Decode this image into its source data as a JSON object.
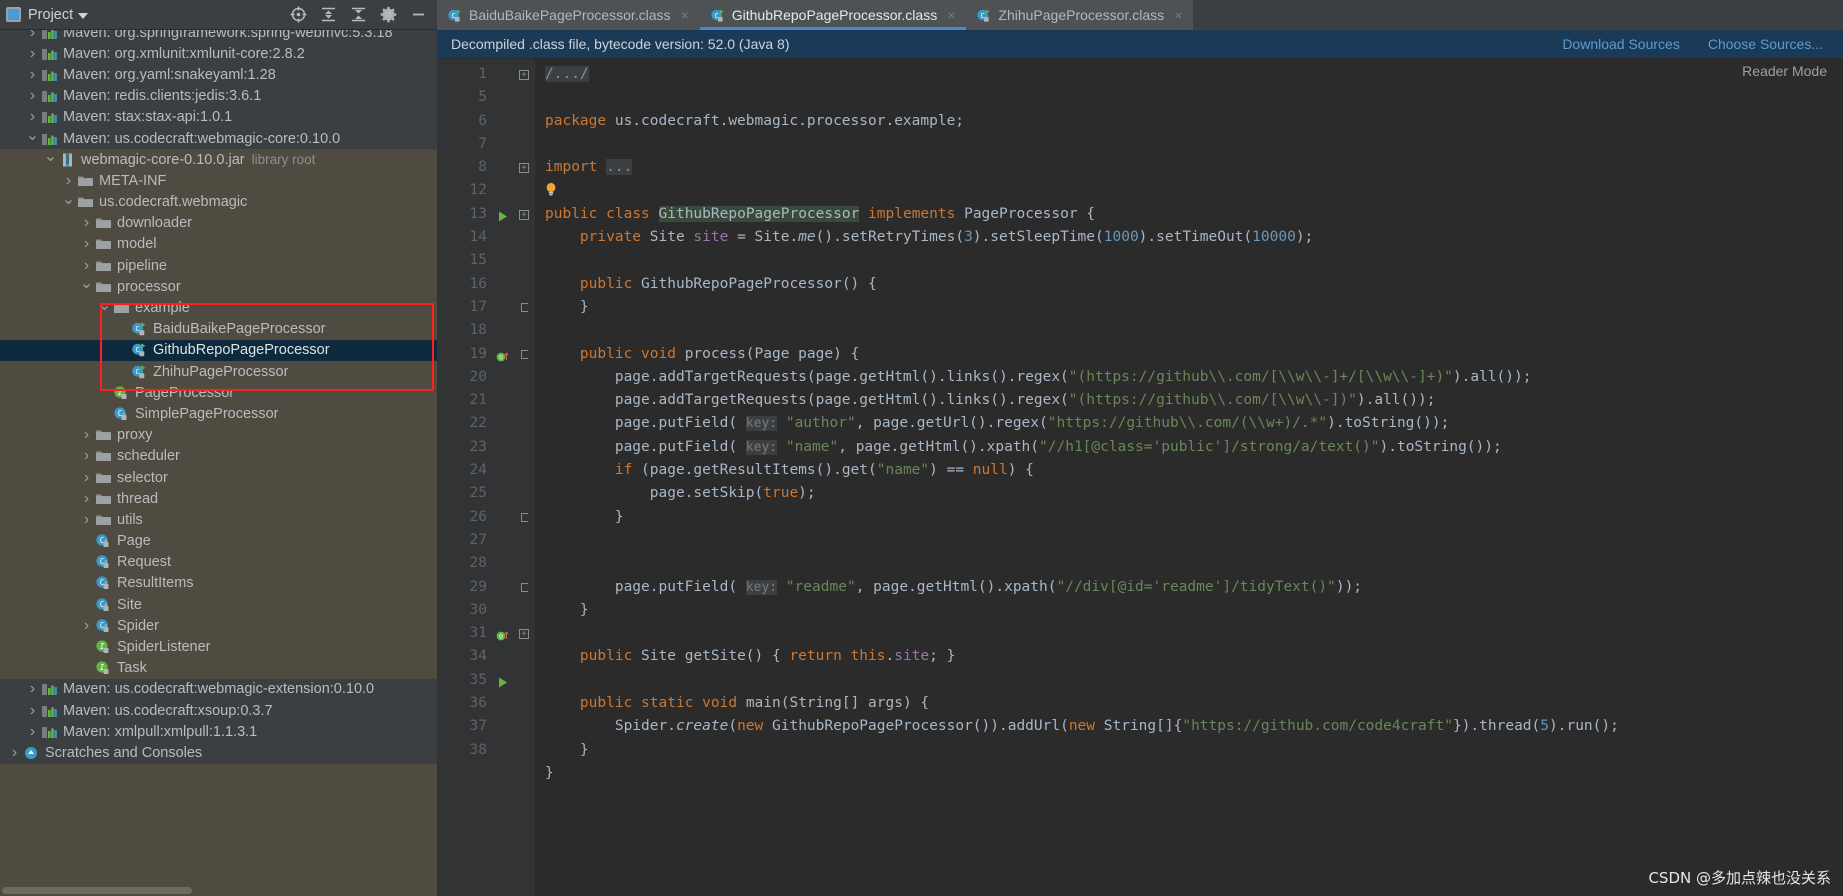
{
  "toolwindow": {
    "title": "Project",
    "icons": [
      "project-icon",
      "locate-icon",
      "expand-all-icon",
      "collapse-all-icon",
      "settings-gear-icon",
      "hide-icon"
    ]
  },
  "tabs": [
    {
      "label": "BaiduBaikePageProcessor.class",
      "active": false,
      "close": "×"
    },
    {
      "label": "GithubRepoPageProcessor.class",
      "active": true,
      "close": "×"
    },
    {
      "label": "ZhihuPageProcessor.class",
      "active": false,
      "close": "×"
    }
  ],
  "notice": {
    "text": "Decompiled .class file, bytecode version: 52.0 (Java 8)",
    "download_sources": "Download Sources",
    "choose_sources": "Choose Sources...",
    "reader_mode": "Reader Mode"
  },
  "tree": [
    {
      "indent": 2,
      "arrow": "›",
      "icon": "maven-lib-icon",
      "label": "Maven: org.springframework:spring-webmvc:5.3.18",
      "cut_top": true,
      "dark": true
    },
    {
      "indent": 2,
      "arrow": "›",
      "icon": "maven-lib-icon",
      "label": "Maven: org.xmlunit:xmlunit-core:2.8.2",
      "dark": true
    },
    {
      "indent": 2,
      "arrow": "›",
      "icon": "maven-lib-icon",
      "label": "Maven: org.yaml:snakeyaml:1.28",
      "dark": true
    },
    {
      "indent": 2,
      "arrow": "›",
      "icon": "maven-lib-icon",
      "label": "Maven: redis.clients:jedis:3.6.1",
      "dark": true
    },
    {
      "indent": 2,
      "arrow": "›",
      "icon": "maven-lib-icon",
      "label": "Maven: stax:stax-api:1.0.1",
      "dark": true
    },
    {
      "indent": 2,
      "arrow": "⌄",
      "icon": "maven-lib-icon",
      "label": "Maven: us.codecraft:webmagic-core:0.10.0",
      "dark": true
    },
    {
      "indent": 3,
      "arrow": "⌄",
      "icon": "jar-icon",
      "label": "webmagic-core-0.10.0.jar",
      "note": "library root"
    },
    {
      "indent": 4,
      "arrow": "›",
      "icon": "folder-icon",
      "label": "META-INF"
    },
    {
      "indent": 4,
      "arrow": "⌄",
      "icon": "folder-icon",
      "label": "us.codecraft.webmagic"
    },
    {
      "indent": 5,
      "arrow": "›",
      "icon": "folder-icon",
      "label": "downloader"
    },
    {
      "indent": 5,
      "arrow": "›",
      "icon": "folder-icon",
      "label": "model"
    },
    {
      "indent": 5,
      "arrow": "›",
      "icon": "folder-icon",
      "label": "pipeline"
    },
    {
      "indent": 5,
      "arrow": "⌄",
      "icon": "folder-icon",
      "label": "processor"
    },
    {
      "indent": 6,
      "arrow": "⌄",
      "icon": "folder-icon",
      "label": "example"
    },
    {
      "indent": 7,
      "arrow": "",
      "icon": "class-runnable-icon",
      "label": "BaiduBaikePageProcessor"
    },
    {
      "indent": 7,
      "arrow": "",
      "icon": "class-runnable-icon",
      "label": "GithubRepoPageProcessor",
      "selected": true
    },
    {
      "indent": 7,
      "arrow": "",
      "icon": "class-runnable-icon",
      "label": "ZhihuPageProcessor"
    },
    {
      "indent": 6,
      "arrow": "",
      "icon": "interface-icon",
      "label": "PageProcessor"
    },
    {
      "indent": 6,
      "arrow": "",
      "icon": "class-icon",
      "label": "SimplePageProcessor"
    },
    {
      "indent": 5,
      "arrow": "›",
      "icon": "folder-icon",
      "label": "proxy"
    },
    {
      "indent": 5,
      "arrow": "›",
      "icon": "folder-icon",
      "label": "scheduler"
    },
    {
      "indent": 5,
      "arrow": "›",
      "icon": "folder-icon",
      "label": "selector"
    },
    {
      "indent": 5,
      "arrow": "›",
      "icon": "folder-icon",
      "label": "thread"
    },
    {
      "indent": 5,
      "arrow": "›",
      "icon": "folder-icon",
      "label": "utils"
    },
    {
      "indent": 5,
      "arrow": "",
      "icon": "class-icon",
      "label": "Page"
    },
    {
      "indent": 5,
      "arrow": "",
      "icon": "class-icon",
      "label": "Request"
    },
    {
      "indent": 5,
      "arrow": "",
      "icon": "class-icon",
      "label": "ResultItems"
    },
    {
      "indent": 5,
      "arrow": "",
      "icon": "class-icon",
      "label": "Site"
    },
    {
      "indent": 5,
      "arrow": "›",
      "icon": "class-icon",
      "label": "Spider"
    },
    {
      "indent": 5,
      "arrow": "",
      "icon": "interface-icon",
      "label": "SpiderListener"
    },
    {
      "indent": 5,
      "arrow": "",
      "icon": "interface-icon",
      "label": "Task"
    },
    {
      "indent": 2,
      "arrow": "›",
      "icon": "maven-lib-icon",
      "label": "Maven: us.codecraft:webmagic-extension:0.10.0",
      "dark": true
    },
    {
      "indent": 2,
      "arrow": "›",
      "icon": "maven-lib-icon",
      "label": "Maven: us.codecraft:xsoup:0.3.7",
      "dark": true
    },
    {
      "indent": 2,
      "arrow": "›",
      "icon": "maven-lib-icon",
      "label": "Maven: xmlpull:xmlpull:1.1.3.1",
      "dark": true
    },
    {
      "indent": 1,
      "arrow": "›",
      "icon": "scratches-icon",
      "label": "Scratches and Consoles",
      "dark": true
    }
  ],
  "code": {
    "line_numbers": [
      "1",
      "5",
      "6",
      "7",
      "8",
      "12",
      "13",
      "14",
      "15",
      "16",
      "17",
      "18",
      "19",
      "20",
      "21",
      "22",
      "23",
      "24",
      "25",
      "26",
      "27",
      "28",
      "29",
      "30",
      "31",
      "34",
      "35",
      "36",
      "37",
      "38"
    ],
    "lines": [
      "/.../",
      "",
      "package us.codecraft.webmagic.processor.example;",
      "",
      "import ...",
      "",
      "public class GithubRepoPageProcessor implements PageProcessor {",
      "    private Site site = Site.me().setRetryTimes(3).setSleepTime(1000).setTimeOut(10000);",
      "",
      "    public GithubRepoPageProcessor() {",
      "    }",
      "",
      "    public void process(Page page) {",
      "        page.addTargetRequests(page.getHtml().links().regex(\"(https://github\\\\.com/[\\\\w\\\\-]+/[\\\\w\\\\-]+)\").all());",
      "        page.addTargetRequests(page.getHtml().links().regex(\"(https://github\\\\.com/[\\\\w\\\\-])\").all());",
      "        page.putField( key: \"author\", page.getUrl().regex(\"https://github\\\\.com/(\\\\w+)/.*\").toString());",
      "        page.putField( key: \"name\", page.getHtml().xpath(\"//h1[@class='public']/strong/a/text()\").toString());",
      "        if (page.getResultItems().get(\"name\") == null) {",
      "            page.setSkip(true);",
      "        }",
      "",
      "",
      "        page.putField( key: \"readme\", page.getHtml().xpath(\"//div[@id='readme']/tidyText()\"));",
      "    }",
      "",
      "    public Site getSite() { return this.site; }",
      "",
      "    public static void main(String[] args) {",
      "        Spider.create(new GithubRepoPageProcessor()).addUrl(new String[]{\"https://github.com/code4craft\"}).thread(5).run();",
      "    }",
      "}"
    ]
  },
  "watermark": "CSDN @多加点辣也没关系"
}
